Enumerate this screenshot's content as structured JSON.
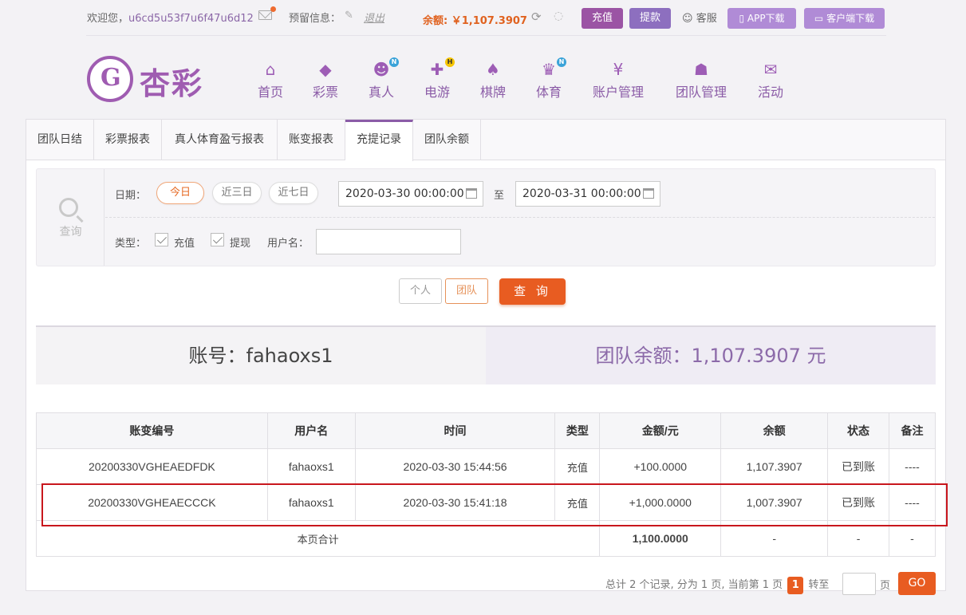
{
  "topbar": {
    "welcome_prefix": "欢迎您，",
    "username": "u6cd5u53f7u6f47u6d12",
    "reserve_label": "预留信息：",
    "logout_label": "退出",
    "balance_label": "余额: ￥1,107.3907",
    "deposit_label": "充值",
    "withdraw_label": "提款",
    "service_label": "客服",
    "app_download_label": "APP下载",
    "client_download_label": "客户端下载"
  },
  "logo": {
    "text": "杏彩"
  },
  "nav": [
    {
      "label": "首页",
      "icon": "home-icon"
    },
    {
      "label": "彩票",
      "icon": "ticket-icon"
    },
    {
      "label": "真人",
      "icon": "dealer-icon",
      "badge": "N"
    },
    {
      "label": "电游",
      "icon": "gamepad-icon",
      "badge": "H"
    },
    {
      "label": "棋牌",
      "icon": "cards-icon"
    },
    {
      "label": "体育",
      "icon": "trophy-icon",
      "badge": "N"
    },
    {
      "label": "账户管理",
      "icon": "yen-icon"
    },
    {
      "label": "团队管理",
      "icon": "team-icon"
    },
    {
      "label": "活动",
      "icon": "gift-icon"
    }
  ],
  "tabs": [
    {
      "label": "团队日结"
    },
    {
      "label": "彩票报表"
    },
    {
      "label": "真人体育盈亏报表"
    },
    {
      "label": "账变报表"
    },
    {
      "label": "充提记录",
      "active": true
    },
    {
      "label": "团队余额"
    }
  ],
  "search": {
    "side_label": "查询",
    "date_label": "日期：",
    "quick_today": "今日",
    "quick_3days": "近三日",
    "quick_7days": "近七日",
    "start_date": "2020-03-30 00:00:00",
    "to_label": "至",
    "end_date": "2020-03-31 00:00:00",
    "type_label": "类型：",
    "type_deposit": "充值",
    "type_withdraw": "提现",
    "username_label": "用户名：",
    "username_value": "",
    "personal_label": "个人",
    "team_label": "团队",
    "query_label": "查 询"
  },
  "summary": {
    "account": "账号：fahaoxs1",
    "team_balance": "团队余额：1,107.3907 元"
  },
  "table": {
    "headers": [
      "账变编号",
      "用户名",
      "时间",
      "类型",
      "金额/元",
      "余额",
      "状态",
      "备注"
    ],
    "rows": [
      [
        "20200330VGHEAEDFDK",
        "fahaoxs1",
        "2020-03-30 15:44:56",
        "充值",
        "+100.0000",
        "1,107.3907",
        "已到账",
        "----"
      ],
      [
        "20200330VGHEAECCCK",
        "fahaoxs1",
        "2020-03-30 15:41:18",
        "充值",
        "+1,000.0000",
        "1,007.3907",
        "已到账",
        "----"
      ]
    ],
    "total_label": "本页合计",
    "total_amount": "1,100.0000",
    "total_balance": "-",
    "total_status": "-",
    "total_note": "-"
  },
  "pager": {
    "text_before": "总计 2 个记录, 分为 1 页, 当前第 1 页",
    "current_page": "1",
    "goto_label": "转至",
    "page_unit": "页",
    "go_label": "GO"
  },
  "colors": {
    "brand_purple": "#9b54a4",
    "accent_orange": "#e85c21",
    "success_green": "#49a338",
    "highlight_red": "#c8171d"
  }
}
